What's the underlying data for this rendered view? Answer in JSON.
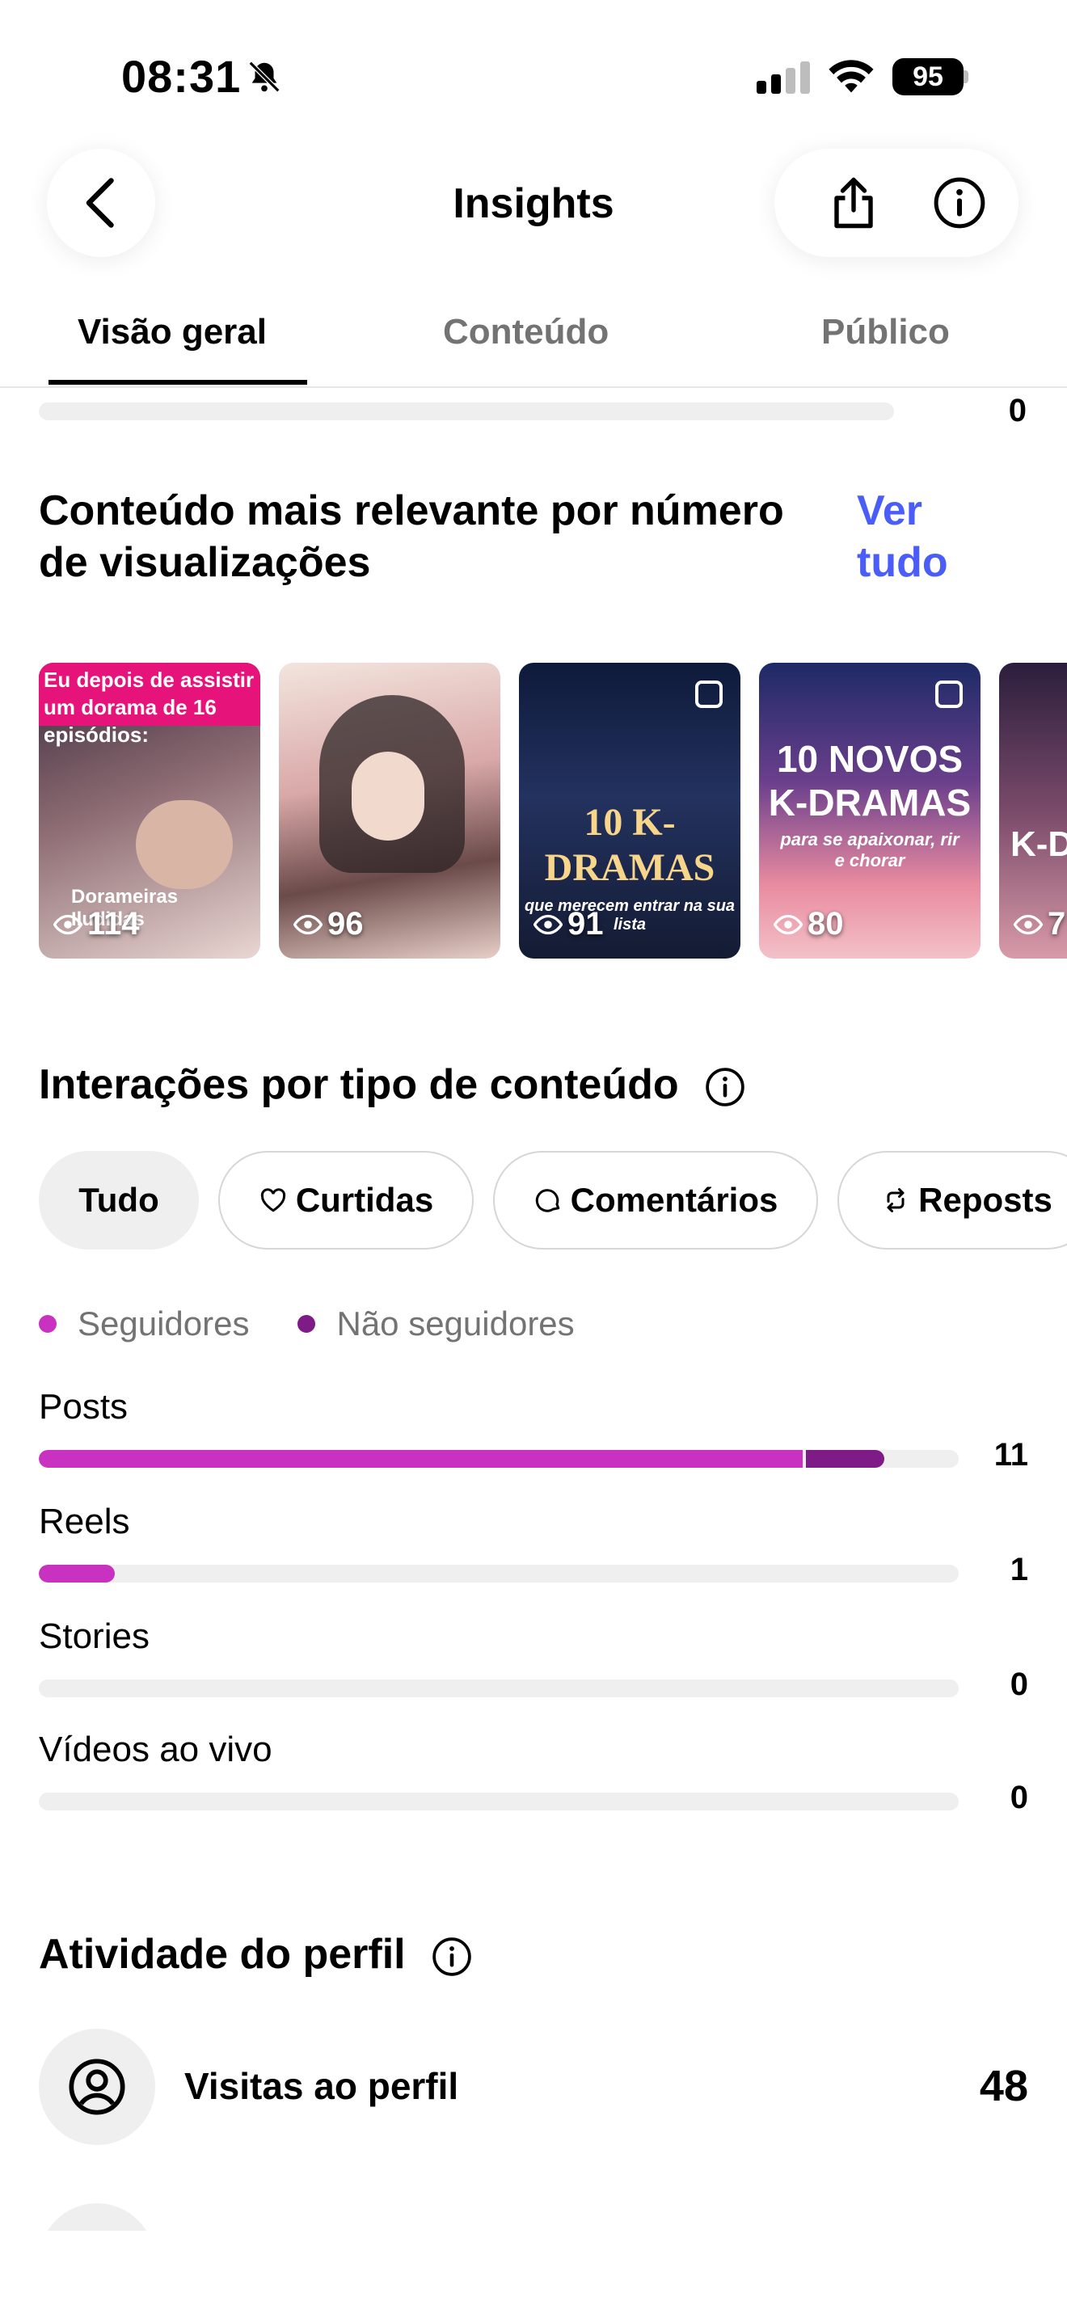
{
  "status_bar": {
    "time": "08:31",
    "battery": "95"
  },
  "header": {
    "title": "Insights"
  },
  "tabs": [
    {
      "label": "Visão geral",
      "active": true
    },
    {
      "label": "Conteúdo",
      "active": false
    },
    {
      "label": "Público",
      "active": false
    }
  ],
  "previous_metric": {
    "value": "0"
  },
  "top_content": {
    "title": "Conteúdo mais relevante por número de visualizações",
    "see_all": "Ver tudo",
    "items": [
      {
        "views": "114",
        "overlay_text": "Eu depois de assistir um dorama de 16 episódios:",
        "footer_text": "Dorameiras Iludidas"
      },
      {
        "views": "96"
      },
      {
        "views": "91",
        "overlay_text": "10 K-DRAMAS",
        "subtitle": "que merecem entrar na sua lista"
      },
      {
        "views": "80",
        "overlay_text": "10 NOVOS K-DRAMAS",
        "subtitle": "para se apaixonar, rir e chorar"
      },
      {
        "views": "7",
        "overlay_text": "K-D"
      }
    ]
  },
  "interactions": {
    "title": "Interações por tipo de conteúdo",
    "filters": [
      {
        "label": "Tudo",
        "icon": "none",
        "active": true
      },
      {
        "label": "Curtidas",
        "icon": "heart-icon",
        "active": false
      },
      {
        "label": "Comentários",
        "icon": "comment-icon",
        "active": false
      },
      {
        "label": "Reposts",
        "icon": "repost-icon",
        "active": false
      }
    ],
    "legend": [
      {
        "label": "Seguidores",
        "color": "#c932c0"
      },
      {
        "label": "Não seguidores",
        "color": "#7e1b86"
      }
    ],
    "rows": [
      {
        "label": "Posts",
        "value": "11",
        "followers_fraction": 0.83,
        "non_followers_fraction": 0.085
      },
      {
        "label": "Reels",
        "value": "1",
        "followers_fraction": 0.083,
        "non_followers_fraction": 0
      },
      {
        "label": "Stories",
        "value": "0",
        "followers_fraction": 0,
        "non_followers_fraction": 0
      },
      {
        "label": "Vídeos ao vivo",
        "value": "0",
        "followers_fraction": 0,
        "non_followers_fraction": 0
      }
    ]
  },
  "profile_activity": {
    "title": "Atividade do perfil",
    "items": [
      {
        "label": "Visitas ao perfil",
        "value": "48",
        "icon": "user-circle-icon"
      }
    ]
  }
}
